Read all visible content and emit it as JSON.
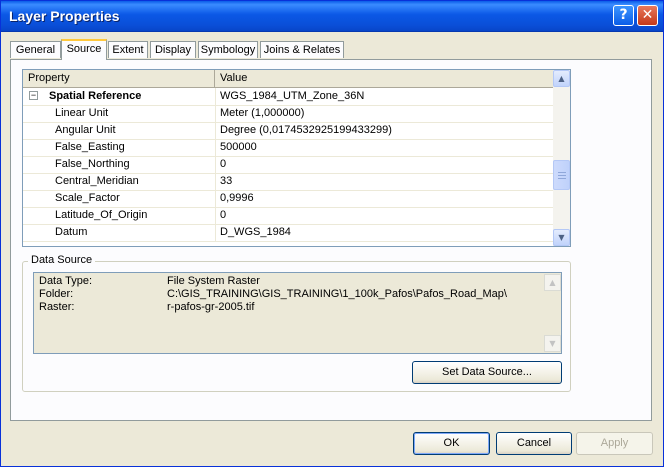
{
  "window": {
    "title": "Layer Properties",
    "help_label": "?",
    "close_label": "✕"
  },
  "tabs": [
    {
      "label": "General"
    },
    {
      "label": "Source"
    },
    {
      "label": "Extent"
    },
    {
      "label": "Display"
    },
    {
      "label": "Symbology"
    },
    {
      "label": "Joins & Relates"
    }
  ],
  "active_tab": "Source",
  "grid": {
    "headers": {
      "property": "Property",
      "value": "Value"
    },
    "rows": [
      {
        "property": "Spatial Reference",
        "value": "WGS_1984_UTM_Zone_36N",
        "group": true,
        "expander": "−"
      },
      {
        "property": "Linear Unit",
        "value": "Meter (1,000000)"
      },
      {
        "property": "Angular Unit",
        "value": "Degree (0,0174532925199433299)"
      },
      {
        "property": "False_Easting",
        "value": "500000"
      },
      {
        "property": "False_Northing",
        "value": "0"
      },
      {
        "property": "Central_Meridian",
        "value": "33"
      },
      {
        "property": "Scale_Factor",
        "value": "0,9996"
      },
      {
        "property": "Latitude_Of_Origin",
        "value": "0"
      },
      {
        "property": "Datum",
        "value": "D_WGS_1984"
      }
    ]
  },
  "data_source": {
    "label": "Data Source",
    "rows": [
      {
        "key": "Data Type:",
        "value": "File System Raster"
      },
      {
        "key": "Folder:",
        "value": "C:\\GIS_TRAINING\\GIS_TRAINING\\1_100k_Pafos\\Pafos_Road_Map\\"
      },
      {
        "key": "Raster:",
        "value": "r-pafos-gr-2005.tif"
      }
    ],
    "set_button": "Set Data Source..."
  },
  "buttons": {
    "ok": "OK",
    "cancel": "Cancel",
    "apply": "Apply"
  },
  "colors": {
    "title_bar": "#0a5ce8",
    "dialog_bg": "#ece9d8",
    "active_tab_accent": "#ffc83c"
  },
  "icons": {
    "scroll_up": "▲",
    "scroll_down": "▼"
  }
}
